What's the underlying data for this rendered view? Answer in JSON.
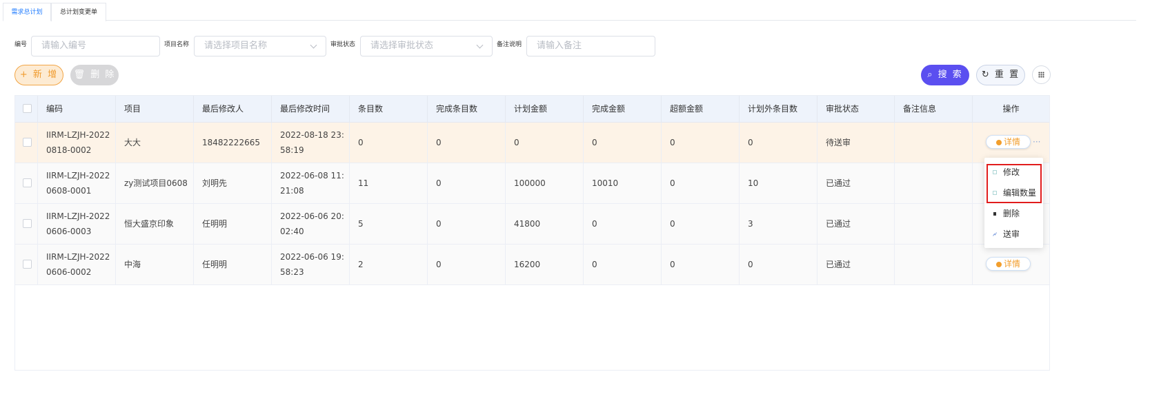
{
  "tabs": [
    {
      "label": "需求总计划",
      "active": true
    },
    {
      "label": "总计划变更单",
      "active": false
    }
  ],
  "filters": {
    "code_label": "编号",
    "code_placeholder": "请输入编号",
    "project_label": "项目名称",
    "project_placeholder": "请选择项目名称",
    "status_label": "审批状态",
    "status_placeholder": "请选择审批状态",
    "remark_label": "备注说明",
    "remark_placeholder": "请输入备注"
  },
  "toolbar": {
    "add_label": "+ 新 增",
    "delete_label": "🗑 删 除",
    "search_label": "⌕ 搜 索",
    "reset_label": "↻ 重 置"
  },
  "table": {
    "headers": [
      "编码",
      "项目",
      "最后修改人",
      "最后修改时间",
      "条目数",
      "完成条目数",
      "计划金额",
      "完成金额",
      "超额金额",
      "计划外条目数",
      "审批状态",
      "备注信息",
      "操作"
    ],
    "rows": [
      [
        "IIRM-LZJH-20220818-0002",
        "大大",
        "18482222665",
        "2022-08-18 23:58:19",
        "0",
        "0",
        "0",
        "0",
        "0",
        "0",
        "待送审",
        ""
      ],
      [
        "IIRM-LZJH-20220608-0001",
        "zy测试项目0608",
        "刘明先",
        "2022-06-08 11:21:08",
        "11",
        "0",
        "100000",
        "10010",
        "0",
        "10",
        "已通过",
        ""
      ],
      [
        "IIRM-LZJH-20220606-0003",
        "恒大盛京印象",
        "任明明",
        "2022-06-06 20:02:40",
        "5",
        "0",
        "41800",
        "0",
        "0",
        "3",
        "已通过",
        ""
      ],
      [
        "IIRM-LZJH-20220606-0002",
        "中海",
        "任明明",
        "2022-06-06 19:58:23",
        "2",
        "0",
        "16200",
        "0",
        "0",
        "0",
        "已通过",
        ""
      ]
    ],
    "detail_label": "详情",
    "more_label": "···"
  },
  "dropdown": {
    "items": [
      {
        "label": "修改",
        "icon": "edit-icon"
      },
      {
        "label": "编辑数量",
        "icon": "edit-icon"
      },
      {
        "label": "删除",
        "icon": "trash-icon"
      },
      {
        "label": "送审",
        "icon": "send-icon"
      }
    ]
  },
  "colors": {
    "accent": "#5b4ff0",
    "warning": "#f29e2c",
    "highlight": "#e11c1c"
  }
}
